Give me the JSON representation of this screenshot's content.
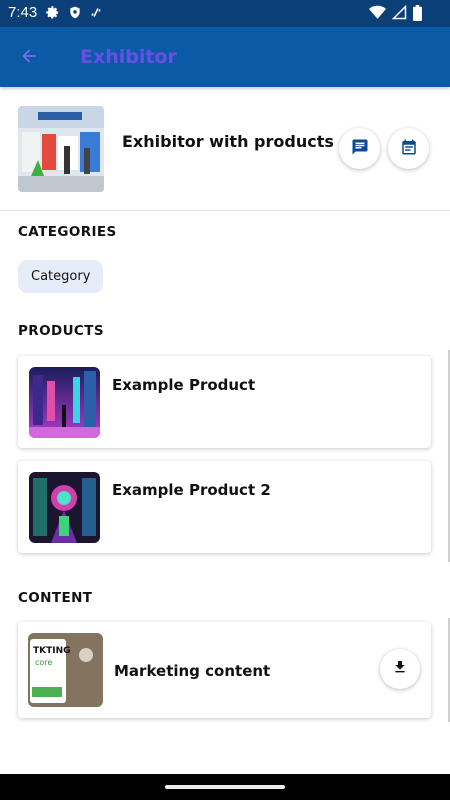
{
  "status_bar": {
    "time": "7:43",
    "icons_left": [
      "gear-icon",
      "shield-icon",
      "link-icon"
    ],
    "icons_right": [
      "wifi-icon",
      "signal-icon",
      "battery-icon"
    ]
  },
  "app_bar": {
    "title": "Exhibitor",
    "back_icon": "arrow-left-icon",
    "title_color": "#6a4ee8",
    "background": "#0b5aa6"
  },
  "exhibitor": {
    "name": "Exhibitor with products",
    "message_icon": "chat-icon",
    "calendar_icon": "calendar-icon"
  },
  "categories": {
    "title": "CATEGORIES",
    "chips": [
      "Category"
    ]
  },
  "products": {
    "title": "PRODUCTS",
    "items": [
      {
        "name": "Example Product"
      },
      {
        "name": "Example Product 2"
      }
    ]
  },
  "content": {
    "title": "CONTENT",
    "items": [
      {
        "name": "Marketing content",
        "action_icon": "download-icon",
        "thumb_text": "TKTING\ncore"
      }
    ]
  }
}
